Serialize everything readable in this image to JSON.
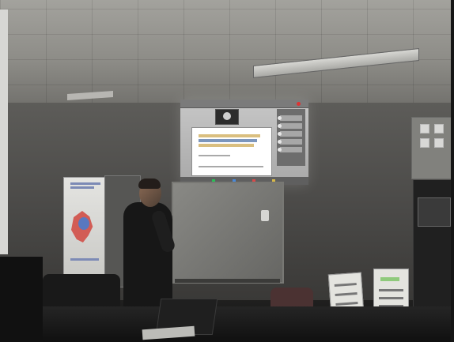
{
  "scene": {
    "palette": {
      "ceiling": "#8d8c87",
      "wall": "#4a4947",
      "projection": "#bdbdbd",
      "slide_background": "#ffffff",
      "accent_red": "#d33333",
      "accent_blue": "#6584b1",
      "accent_gold": "#d3b46a",
      "accent_green": "#8fca7c"
    },
    "objects": {
      "projection_icon": "projector-screen-icon",
      "presenter_icon": "person-icon",
      "banner_icon": "map-icon",
      "poster_icon": "document-icon"
    }
  }
}
